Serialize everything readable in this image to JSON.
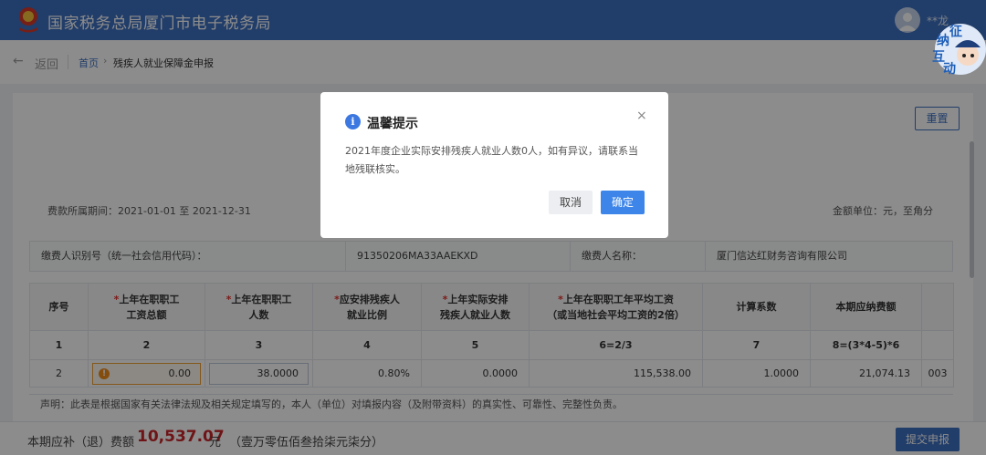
{
  "header": {
    "title": "国家税务总局厦门市电子税务局",
    "user": "**龙",
    "mascot": [
      "征",
      "纳",
      "互",
      "动"
    ]
  },
  "breadcrumb": {
    "back": "返回",
    "home": "首页",
    "sep": "›",
    "current": "残疾人就业保障金申报"
  },
  "toolbar": {
    "reset": "重置"
  },
  "period": {
    "label": "费款所属期间：",
    "range": "2021-01-01 至 2021-12-31"
  },
  "unit": "金额单位：元，至角分",
  "payer": {
    "id_label": "缴费人识别号（统一社会信用代码）：",
    "id_value": "91350206MA33AAEKXD",
    "name_label": "缴费人名称：",
    "name_value": "厦门信达红财务咨询有限公司"
  },
  "table": {
    "headers": [
      {
        "req": "",
        "l1": "序号",
        "l2": ""
      },
      {
        "req": "*",
        "l1": "上年在职职工",
        "l2": "工资总额"
      },
      {
        "req": "*",
        "l1": "上年在职职工",
        "l2": "人数"
      },
      {
        "req": "*",
        "l1": "应安排残疾人",
        "l2": "就业比例"
      },
      {
        "req": "*",
        "l1": "上年实际安排",
        "l2": "残疾人就业人数"
      },
      {
        "req": "*",
        "l1": "上年在职职工年平均工资",
        "l2": "（或当地社会平均工资的2倍）"
      },
      {
        "req": "",
        "l1": "计算系数",
        "l2": ""
      },
      {
        "req": "",
        "l1": "本期应纳费额",
        "l2": ""
      },
      {
        "req": "",
        "l1": "",
        "l2": ""
      }
    ],
    "indices": [
      "1",
      "2",
      "3",
      "4",
      "5",
      "6=2/3",
      "7",
      "8=(3*4-5)*6",
      ""
    ],
    "row": [
      "2",
      "0.00",
      "38.0000",
      "0.80%",
      "0.0000",
      "115,538.00",
      "1.0000",
      "21,074.13",
      "003"
    ],
    "warn_icon": "!"
  },
  "note": "声明：此表是根据国家有关法律法规及相关规定填写的，本人（单位）对填报内容（及附带资料）的真实性、可靠性、完整性负责。",
  "footer": {
    "due_label": "本期应补（退）费额",
    "due_amount": "10,537.07",
    "due_unit": "元",
    "due_words": "（壹万零伍佰叁拾柒元柒分）",
    "submit": "提交申报"
  },
  "modal": {
    "icon": "i",
    "title": "温馨提示",
    "close": "×",
    "message": "2021年度企业实际安排残疾人就业人数0人，如有异议，请联系当地残联核实。",
    "cancel": "取消",
    "ok": "确定"
  },
  "colors": {
    "brand": "#3c6fc0",
    "amount": "#c8262b",
    "primary_button": "#3d85e8"
  }
}
